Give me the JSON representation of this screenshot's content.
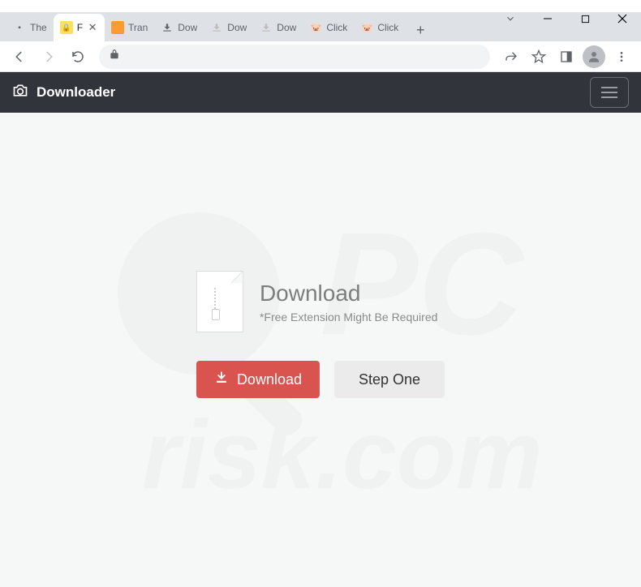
{
  "tabs": [
    {
      "title": "The",
      "icon": "🔲"
    },
    {
      "title": "F",
      "icon": "🔒",
      "active": true
    },
    {
      "title": "Tran",
      "icon": "🟧"
    },
    {
      "title": "Dow",
      "icon": "⬇"
    },
    {
      "title": "Dow",
      "icon": "⬇"
    },
    {
      "title": "Dow",
      "icon": "⬇"
    },
    {
      "title": "Click",
      "icon": "🔧"
    },
    {
      "title": "Click",
      "icon": "🔧"
    }
  ],
  "header": {
    "brand": "Downloader"
  },
  "download": {
    "title": "Download",
    "subtitle": "*Free Extension Might Be Required",
    "download_btn": "Download",
    "step_btn": "Step One"
  },
  "watermark": {
    "text1": "PC",
    "text2": "risk.com"
  }
}
